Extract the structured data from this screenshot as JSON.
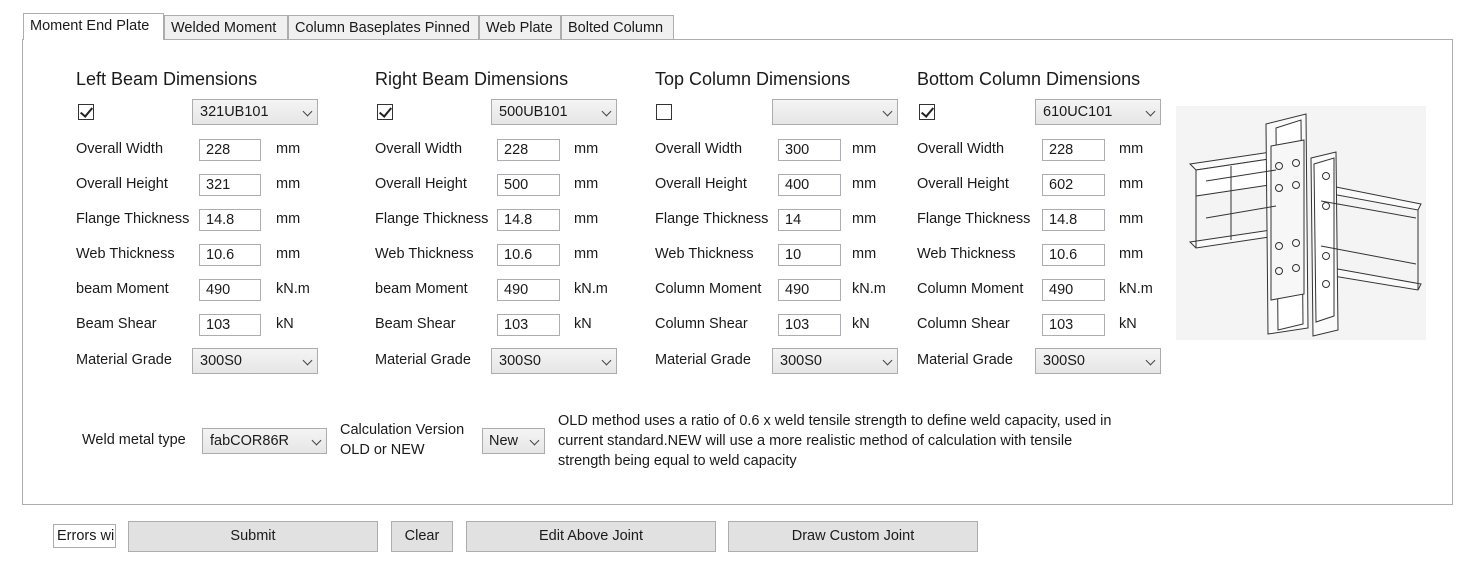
{
  "tabs": [
    "Moment End Plate",
    "Welded Moment",
    "Column Baseplates Pinned",
    "Web Plate",
    "Bolted Column"
  ],
  "active_tab": "Moment End Plate",
  "sections": [
    {
      "title": "Left Beam Dimensions",
      "checked": true,
      "section_value": "321UB101",
      "fields": [
        {
          "label": "Overall Width",
          "value": "228",
          "unit": "mm"
        },
        {
          "label": "Overall Height",
          "value": "321",
          "unit": "mm"
        },
        {
          "label": "Flange Thickness",
          "value": "14.8",
          "unit": "mm"
        },
        {
          "label": "Web Thickness",
          "value": "10.6",
          "unit": "mm"
        },
        {
          "label": "beam Moment",
          "value": "490",
          "unit": "kN.m"
        },
        {
          "label": "Beam Shear",
          "value": "103",
          "unit": "kN"
        }
      ],
      "material_label": "Material Grade",
      "material_value": "300S0"
    },
    {
      "title": "Right Beam Dimensions",
      "checked": true,
      "section_value": "500UB101",
      "fields": [
        {
          "label": "Overall Width",
          "value": "228",
          "unit": "mm"
        },
        {
          "label": "Overall Height",
          "value": "500",
          "unit": "mm"
        },
        {
          "label": "Flange Thickness",
          "value": "14.8",
          "unit": "mm"
        },
        {
          "label": "Web Thickness",
          "value": "10.6",
          "unit": "mm"
        },
        {
          "label": "beam Moment",
          "value": "490",
          "unit": "kN.m"
        },
        {
          "label": "Beam Shear",
          "value": "103",
          "unit": "kN"
        }
      ],
      "material_label": "Material Grade",
      "material_value": "300S0"
    },
    {
      "title": "Top Column Dimensions",
      "checked": false,
      "section_value": "",
      "fields": [
        {
          "label": "Overall Width",
          "value": "300",
          "unit": "mm"
        },
        {
          "label": "Overall Height",
          "value": "400",
          "unit": "mm"
        },
        {
          "label": "Flange Thickness",
          "value": "14",
          "unit": "mm"
        },
        {
          "label": "Web Thickness",
          "value": "10",
          "unit": "mm"
        },
        {
          "label": "Column Moment",
          "value": "490",
          "unit": "kN.m"
        },
        {
          "label": "Column Shear",
          "value": "103",
          "unit": "kN"
        }
      ],
      "material_label": "Material Grade",
      "material_value": "300S0"
    },
    {
      "title": "Bottom Column Dimensions",
      "checked": true,
      "section_value": "610UC101",
      "fields": [
        {
          "label": "Overall Width",
          "value": "228",
          "unit": "mm"
        },
        {
          "label": "Overall Height",
          "value": "602",
          "unit": "mm"
        },
        {
          "label": "Flange Thickness",
          "value": "14.8",
          "unit": "mm"
        },
        {
          "label": "Web Thickness",
          "value": "10.6",
          "unit": "mm"
        },
        {
          "label": "Column Moment",
          "value": "490",
          "unit": "kN.m"
        },
        {
          "label": "Column Shear",
          "value": "103",
          "unit": "kN"
        }
      ],
      "material_label": "Material Grade",
      "material_value": "300S0"
    }
  ],
  "weld": {
    "label": "Weld metal type",
    "value": "fabCOR86R",
    "calc_label_line1": "Calculation Version",
    "calc_label_line2": "OLD or NEW",
    "calc_value": "New",
    "note": "OLD method uses a ratio of 0.6 x weld tensile strength to define weld capacity, used in current standard.NEW will use a more realistic method of calculation with tensile strength being equal to weld capacity"
  },
  "bottom": {
    "errors_value": "Errors wi",
    "submit_label": "Submit",
    "clear_label": "Clear",
    "edit_label": "Edit Above Joint",
    "draw_label": "Draw Custom Joint"
  },
  "icons": {
    "checkbox": "check-icon",
    "dropdown": "chevron-down-icon",
    "joint_image": "joint-diagram-icon"
  }
}
